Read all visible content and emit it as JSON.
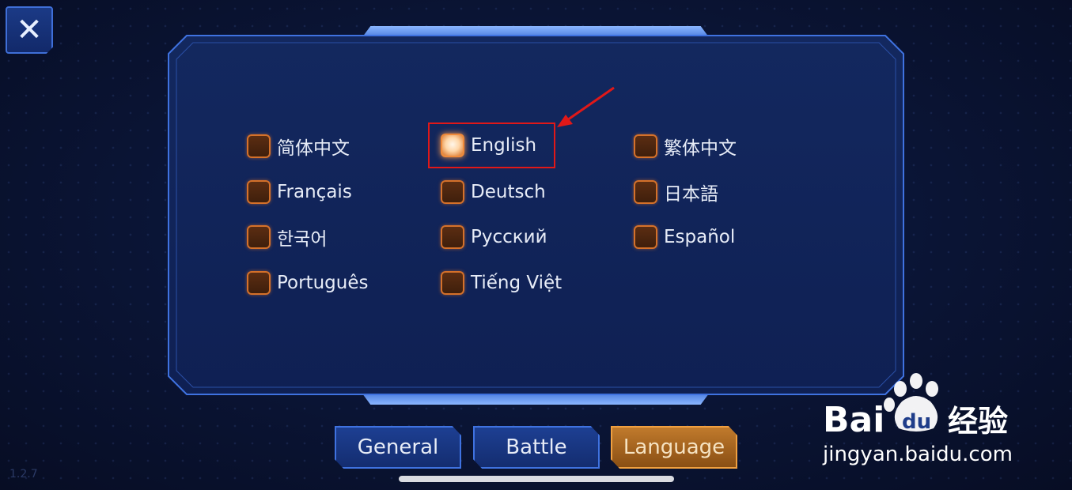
{
  "close_button": {
    "icon": "close-icon",
    "glyph": "✕"
  },
  "version": "1.2.7",
  "languages": [
    {
      "label": "简体中文",
      "selected": false
    },
    {
      "label": "English",
      "selected": true
    },
    {
      "label": "繁体中文",
      "selected": false
    },
    {
      "label": "Français",
      "selected": false
    },
    {
      "label": "Deutsch",
      "selected": false
    },
    {
      "label": "日本語",
      "selected": false
    },
    {
      "label": "한국어",
      "selected": false
    },
    {
      "label": "Русский",
      "selected": false
    },
    {
      "label": "Español",
      "selected": false
    },
    {
      "label": "Português",
      "selected": false
    },
    {
      "label": "Tiếng Việt",
      "selected": false
    }
  ],
  "tabs": [
    {
      "label": "General",
      "active": false
    },
    {
      "label": "Battle",
      "active": false
    },
    {
      "label": "Language",
      "active": true
    }
  ],
  "watermark": {
    "brand_text": "Bai du 经验",
    "url": "jingyan.baidu.com"
  },
  "colors": {
    "accent_orange": "#d5712a",
    "panel_border": "#3f72e0",
    "annotation_red": "#e01818"
  }
}
